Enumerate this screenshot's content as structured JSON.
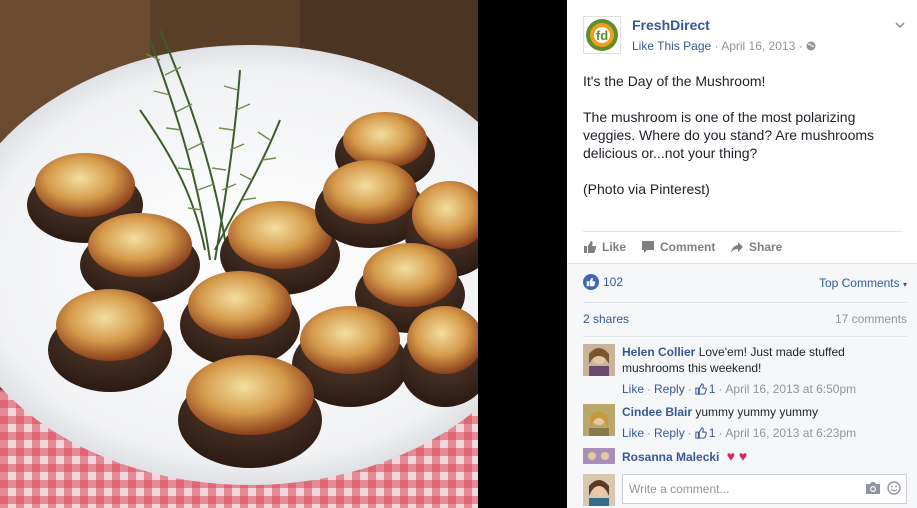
{
  "photo": {
    "icon": "stuffed-mushrooms-photo"
  },
  "post": {
    "page_name": "FreshDirect",
    "like_page": "Like This Page",
    "separator": "·",
    "date": "April 16, 2013",
    "separator2": "·",
    "privacy_icon": "globe-icon",
    "text_line1": "It's the Day of the Mushroom!",
    "text_line2": "The mushroom is one of the most polarizing veggies. Where do you stand? Are mushrooms delicious or...not your thing?",
    "text_line3": "(Photo via Pinterest)"
  },
  "actions": {
    "like": "Like",
    "comment": "Comment",
    "share": "Share"
  },
  "feedback": {
    "like_count": "102",
    "top_comments": "Top Comments",
    "shares": "2 shares",
    "comments_count": "17 comments"
  },
  "comments": [
    {
      "name": "Helen Collier",
      "text": "Love'em! Just made stuffed mushrooms this weekend!",
      "like": "Like",
      "reply": "Reply",
      "likes": "1",
      "time": "April 16, 2013 at 6:50pm"
    },
    {
      "name": "Cindee Blair",
      "text": "yummy yummy yummy",
      "like": "Like",
      "reply": "Reply",
      "likes": "1",
      "time": "April 16, 2013 at 6:23pm"
    },
    {
      "name": "Rosanna Malecki",
      "hearts": "♥ ♥"
    }
  ],
  "compose": {
    "placeholder": "Write a comment..."
  },
  "meta_sep": "·",
  "colors": {
    "link": "#365899",
    "muted": "#90949c",
    "like_blue": "#4267b2"
  }
}
